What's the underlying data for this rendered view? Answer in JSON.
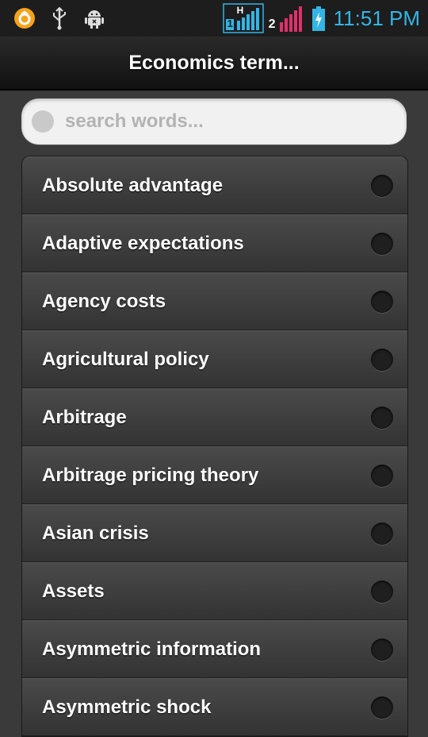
{
  "status_bar": {
    "time": "11:51 PM",
    "icons": [
      "notification-ring-icon",
      "usb-icon",
      "android-debug-icon",
      "signal-sim1-icon",
      "signal-sim2-icon",
      "battery-charging-icon"
    ],
    "sim1_label": "1",
    "sim1_network": "H",
    "sim2_label": "2",
    "colors": {
      "time": "#33b5e5",
      "sim1": "#33b5e5",
      "sim2": "#e0306b",
      "notification": "#f7a21b"
    }
  },
  "titlebar": {
    "title": "Economics term..."
  },
  "search": {
    "placeholder": "search words..."
  },
  "list": {
    "items": [
      "Absolute advantage",
      "Adaptive expectations",
      "Agency costs",
      "Agricultural policy",
      "Arbitrage",
      "Arbitrage pricing theory",
      "Asian crisis",
      "Assets",
      "Asymmetric information",
      "Asymmetric shock"
    ]
  }
}
